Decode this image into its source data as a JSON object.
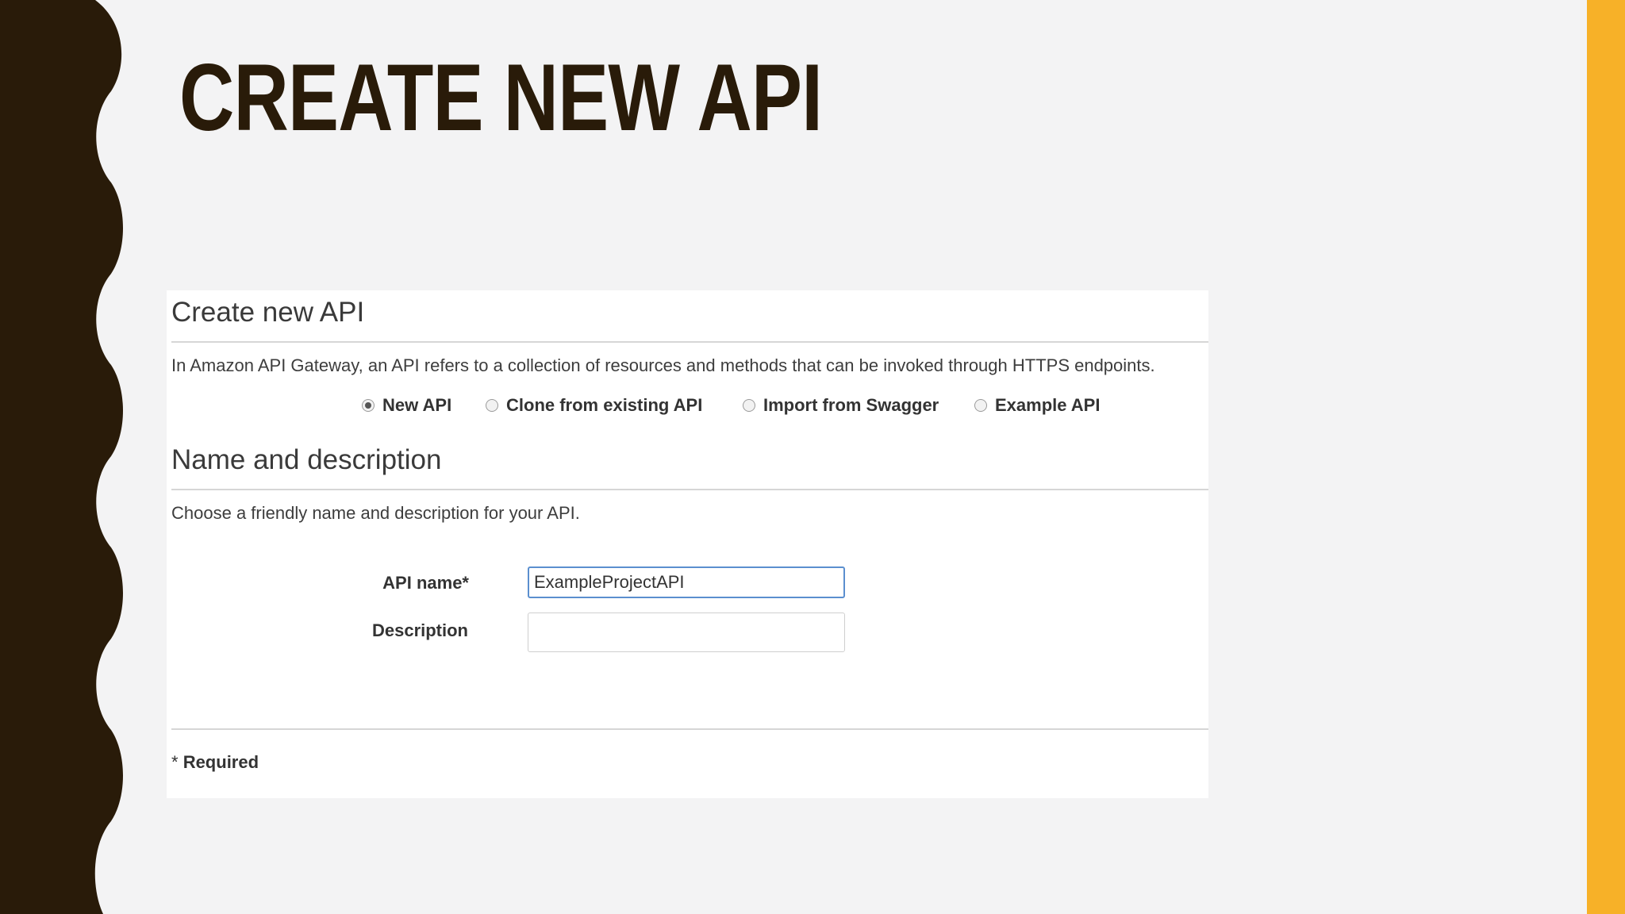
{
  "slide": {
    "title": "CREATE NEW API",
    "colors": {
      "dark_wave": "#291b09",
      "accent_bar": "#f7b128",
      "background": "#f3f3f4"
    }
  },
  "panel": {
    "heading": "Create new API",
    "intro": "In Amazon API Gateway, an API refers to a collection of resources and methods that can be invoked through HTTPS endpoints.",
    "radio_options": [
      {
        "label": "New API",
        "checked": true
      },
      {
        "label": "Clone from existing API",
        "checked": false
      },
      {
        "label": "Import from Swagger",
        "checked": false
      },
      {
        "label": "Example API",
        "checked": false
      }
    ],
    "section_heading": "Name and description",
    "section_help": "Choose a friendly name and description for your API.",
    "fields": {
      "api_name": {
        "label": "API name*",
        "value": "ExampleProjectAPI"
      },
      "description": {
        "label": "Description",
        "value": ""
      }
    },
    "required_asterisk": "*",
    "required_note": "Required"
  }
}
